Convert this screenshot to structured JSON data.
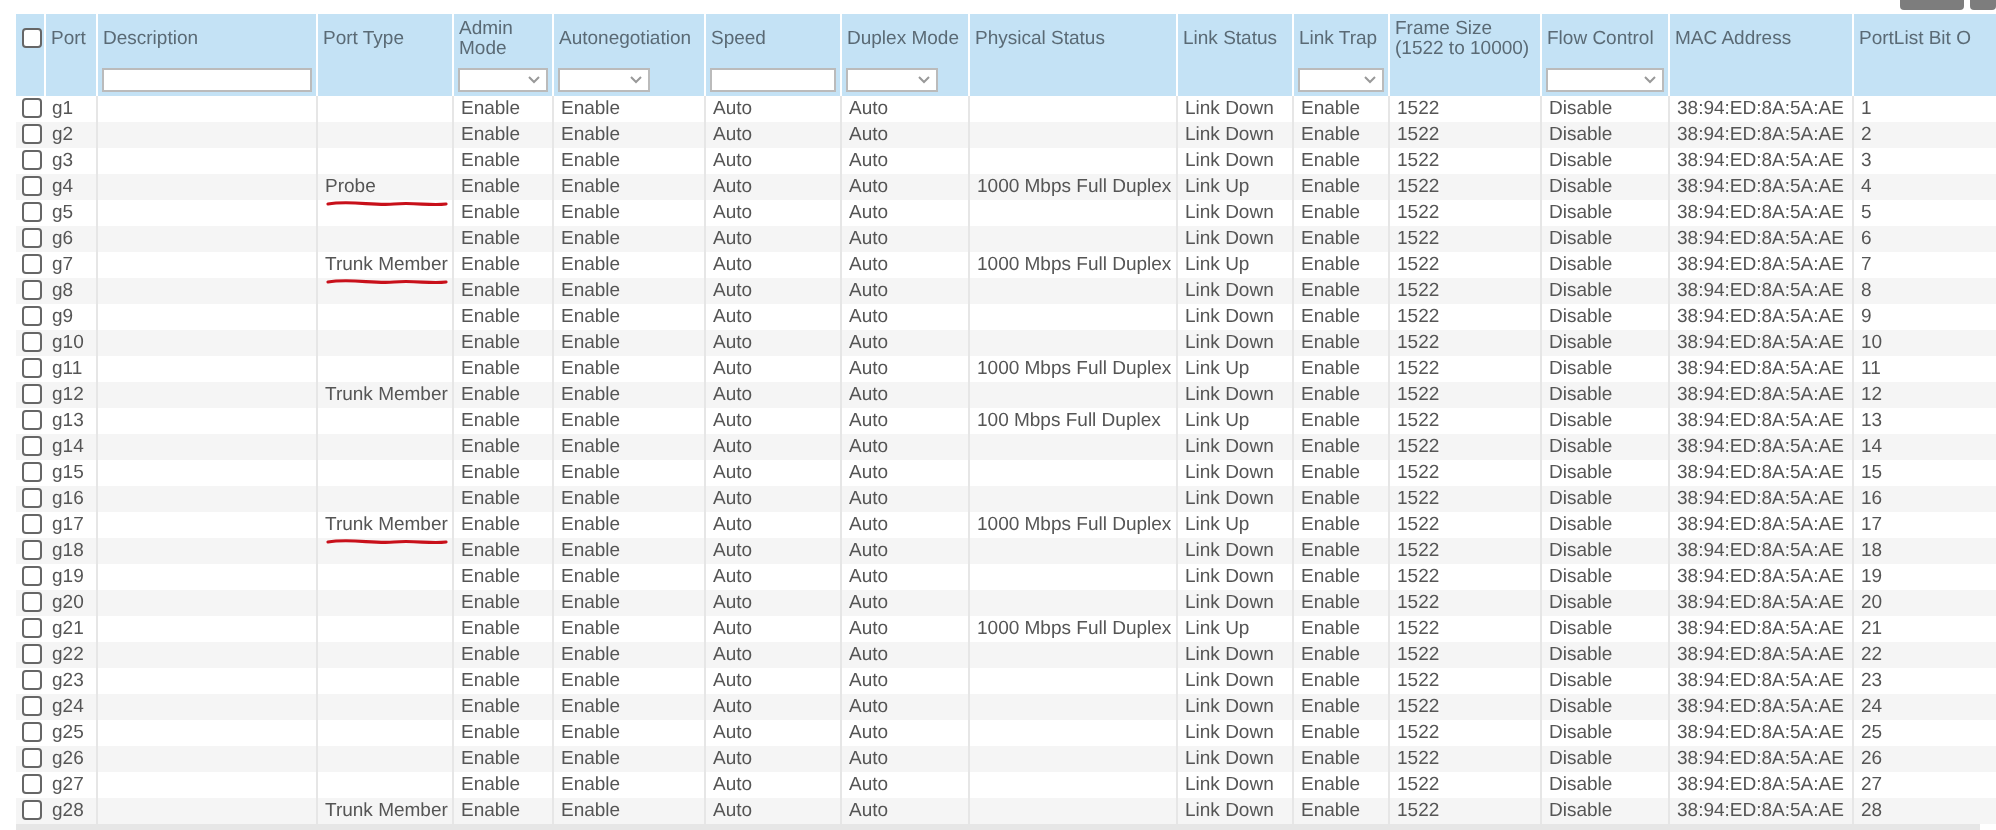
{
  "select_all": {
    "checked": false
  },
  "columns": [
    {
      "label": "Port",
      "kind": "plain"
    },
    {
      "label": "Description",
      "kind": "text_filter"
    },
    {
      "label": "Port Type",
      "kind": "plain"
    },
    {
      "label": "Admin Mode",
      "kind": "select_filter"
    },
    {
      "label": "Autonegotiation",
      "kind": "select_filter"
    },
    {
      "label": "Speed",
      "kind": "text_filter"
    },
    {
      "label": "Duplex Mode",
      "kind": "select_filter"
    },
    {
      "label": "Physical Status",
      "kind": "plain"
    },
    {
      "label": "Link Status",
      "kind": "plain"
    },
    {
      "label": "Link Trap",
      "kind": "select_filter"
    },
    {
      "label": "Frame Size (1522 to 10000)",
      "kind": "plain"
    },
    {
      "label": "Flow Control",
      "kind": "select_filter"
    },
    {
      "label": "MAC Address",
      "kind": "plain"
    },
    {
      "label": "PortList Bit O",
      "kind": "plain"
    }
  ],
  "rows": [
    {
      "checked": false,
      "underlined": false,
      "cells": [
        "g1",
        null,
        null,
        "Enable",
        "Enable",
        "Auto",
        "Auto",
        null,
        "Link Down",
        "Enable",
        "1522",
        "Disable",
        "38:94:ED:8A:5A:AE",
        "1"
      ]
    },
    {
      "checked": false,
      "underlined": false,
      "cells": [
        "g2",
        null,
        null,
        "Enable",
        "Enable",
        "Auto",
        "Auto",
        null,
        "Link Down",
        "Enable",
        "1522",
        "Disable",
        "38:94:ED:8A:5A:AE",
        "2"
      ]
    },
    {
      "checked": false,
      "underlined": false,
      "cells": [
        "g3",
        null,
        null,
        "Enable",
        "Enable",
        "Auto",
        "Auto",
        null,
        "Link Down",
        "Enable",
        "1522",
        "Disable",
        "38:94:ED:8A:5A:AE",
        "3"
      ]
    },
    {
      "checked": false,
      "underlined": true,
      "cells": [
        "g4",
        null,
        "Probe",
        "Enable",
        "Enable",
        "Auto",
        "Auto",
        "1000 Mbps Full Duplex",
        "Link Up",
        "Enable",
        "1522",
        "Disable",
        "38:94:ED:8A:5A:AE",
        "4"
      ]
    },
    {
      "checked": false,
      "underlined": false,
      "cells": [
        "g5",
        null,
        null,
        "Enable",
        "Enable",
        "Auto",
        "Auto",
        null,
        "Link Down",
        "Enable",
        "1522",
        "Disable",
        "38:94:ED:8A:5A:AE",
        "5"
      ]
    },
    {
      "checked": false,
      "underlined": false,
      "cells": [
        "g6",
        null,
        null,
        "Enable",
        "Enable",
        "Auto",
        "Auto",
        null,
        "Link Down",
        "Enable",
        "1522",
        "Disable",
        "38:94:ED:8A:5A:AE",
        "6"
      ]
    },
    {
      "checked": false,
      "underlined": true,
      "cells": [
        "g7",
        null,
        "Trunk Member",
        "Enable",
        "Enable",
        "Auto",
        "Auto",
        "1000 Mbps Full Duplex",
        "Link Up",
        "Enable",
        "1522",
        "Disable",
        "38:94:ED:8A:5A:AE",
        "7"
      ]
    },
    {
      "checked": false,
      "underlined": false,
      "cells": [
        "g8",
        null,
        null,
        "Enable",
        "Enable",
        "Auto",
        "Auto",
        null,
        "Link Down",
        "Enable",
        "1522",
        "Disable",
        "38:94:ED:8A:5A:AE",
        "8"
      ]
    },
    {
      "checked": false,
      "underlined": false,
      "cells": [
        "g9",
        null,
        null,
        "Enable",
        "Enable",
        "Auto",
        "Auto",
        null,
        "Link Down",
        "Enable",
        "1522",
        "Disable",
        "38:94:ED:8A:5A:AE",
        "9"
      ]
    },
    {
      "checked": false,
      "underlined": false,
      "cells": [
        "g10",
        null,
        null,
        "Enable",
        "Enable",
        "Auto",
        "Auto",
        null,
        "Link Down",
        "Enable",
        "1522",
        "Disable",
        "38:94:ED:8A:5A:AE",
        "10"
      ]
    },
    {
      "checked": false,
      "underlined": false,
      "cells": [
        "g11",
        null,
        null,
        "Enable",
        "Enable",
        "Auto",
        "Auto",
        "1000 Mbps Full Duplex",
        "Link Up",
        "Enable",
        "1522",
        "Disable",
        "38:94:ED:8A:5A:AE",
        "11"
      ]
    },
    {
      "checked": false,
      "underlined": false,
      "cells": [
        "g12",
        null,
        "Trunk Member",
        "Enable",
        "Enable",
        "Auto",
        "Auto",
        null,
        "Link Down",
        "Enable",
        "1522",
        "Disable",
        "38:94:ED:8A:5A:AE",
        "12"
      ]
    },
    {
      "checked": false,
      "underlined": false,
      "cells": [
        "g13",
        null,
        null,
        "Enable",
        "Enable",
        "Auto",
        "Auto",
        "100 Mbps Full Duplex",
        "Link Up",
        "Enable",
        "1522",
        "Disable",
        "38:94:ED:8A:5A:AE",
        "13"
      ]
    },
    {
      "checked": false,
      "underlined": false,
      "cells": [
        "g14",
        null,
        null,
        "Enable",
        "Enable",
        "Auto",
        "Auto",
        null,
        "Link Down",
        "Enable",
        "1522",
        "Disable",
        "38:94:ED:8A:5A:AE",
        "14"
      ]
    },
    {
      "checked": false,
      "underlined": false,
      "cells": [
        "g15",
        null,
        null,
        "Enable",
        "Enable",
        "Auto",
        "Auto",
        null,
        "Link Down",
        "Enable",
        "1522",
        "Disable",
        "38:94:ED:8A:5A:AE",
        "15"
      ]
    },
    {
      "checked": false,
      "underlined": false,
      "cells": [
        "g16",
        null,
        null,
        "Enable",
        "Enable",
        "Auto",
        "Auto",
        null,
        "Link Down",
        "Enable",
        "1522",
        "Disable",
        "38:94:ED:8A:5A:AE",
        "16"
      ]
    },
    {
      "checked": false,
      "underlined": true,
      "cells": [
        "g17",
        null,
        "Trunk Member",
        "Enable",
        "Enable",
        "Auto",
        "Auto",
        "1000 Mbps Full Duplex",
        "Link Up",
        "Enable",
        "1522",
        "Disable",
        "38:94:ED:8A:5A:AE",
        "17"
      ]
    },
    {
      "checked": false,
      "underlined": false,
      "cells": [
        "g18",
        null,
        null,
        "Enable",
        "Enable",
        "Auto",
        "Auto",
        null,
        "Link Down",
        "Enable",
        "1522",
        "Disable",
        "38:94:ED:8A:5A:AE",
        "18"
      ]
    },
    {
      "checked": false,
      "underlined": false,
      "cells": [
        "g19",
        null,
        null,
        "Enable",
        "Enable",
        "Auto",
        "Auto",
        null,
        "Link Down",
        "Enable",
        "1522",
        "Disable",
        "38:94:ED:8A:5A:AE",
        "19"
      ]
    },
    {
      "checked": false,
      "underlined": false,
      "cells": [
        "g20",
        null,
        null,
        "Enable",
        "Enable",
        "Auto",
        "Auto",
        null,
        "Link Down",
        "Enable",
        "1522",
        "Disable",
        "38:94:ED:8A:5A:AE",
        "20"
      ]
    },
    {
      "checked": false,
      "underlined": false,
      "cells": [
        "g21",
        null,
        null,
        "Enable",
        "Enable",
        "Auto",
        "Auto",
        "1000 Mbps Full Duplex",
        "Link Up",
        "Enable",
        "1522",
        "Disable",
        "38:94:ED:8A:5A:AE",
        "21"
      ]
    },
    {
      "checked": false,
      "underlined": false,
      "cells": [
        "g22",
        null,
        null,
        "Enable",
        "Enable",
        "Auto",
        "Auto",
        null,
        "Link Down",
        "Enable",
        "1522",
        "Disable",
        "38:94:ED:8A:5A:AE",
        "22"
      ]
    },
    {
      "checked": false,
      "underlined": false,
      "cells": [
        "g23",
        null,
        null,
        "Enable",
        "Enable",
        "Auto",
        "Auto",
        null,
        "Link Down",
        "Enable",
        "1522",
        "Disable",
        "38:94:ED:8A:5A:AE",
        "23"
      ]
    },
    {
      "checked": false,
      "underlined": false,
      "cells": [
        "g24",
        null,
        null,
        "Enable",
        "Enable",
        "Auto",
        "Auto",
        null,
        "Link Down",
        "Enable",
        "1522",
        "Disable",
        "38:94:ED:8A:5A:AE",
        "24"
      ]
    },
    {
      "checked": false,
      "underlined": false,
      "cells": [
        "g25",
        null,
        null,
        "Enable",
        "Enable",
        "Auto",
        "Auto",
        null,
        "Link Down",
        "Enable",
        "1522",
        "Disable",
        "38:94:ED:8A:5A:AE",
        "25"
      ]
    },
    {
      "checked": false,
      "underlined": false,
      "cells": [
        "g26",
        null,
        null,
        "Enable",
        "Enable",
        "Auto",
        "Auto",
        null,
        "Link Down",
        "Enable",
        "1522",
        "Disable",
        "38:94:ED:8A:5A:AE",
        "26"
      ]
    },
    {
      "checked": false,
      "underlined": false,
      "cells": [
        "g27",
        null,
        null,
        "Enable",
        "Enable",
        "Auto",
        "Auto",
        null,
        "Link Down",
        "Enable",
        "1522",
        "Disable",
        "38:94:ED:8A:5A:AE",
        "27"
      ]
    },
    {
      "checked": false,
      "underlined": false,
      "cells": [
        "g28",
        null,
        "Trunk Member",
        "Enable",
        "Enable",
        "Auto",
        "Auto",
        null,
        "Link Down",
        "Enable",
        "1522",
        "Disable",
        "38:94:ED:8A:5A:AE",
        "28"
      ]
    }
  ]
}
